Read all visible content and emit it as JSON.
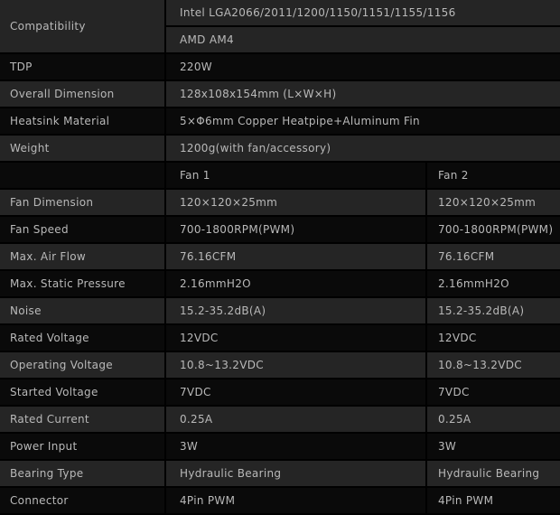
{
  "compatibility": {
    "label": "Compatibility",
    "intel": "Intel LGA2066/2011/1200/1150/1151/1155/1156",
    "amd": "AMD AM4"
  },
  "general": [
    {
      "label": "TDP",
      "value": "220W"
    },
    {
      "label": "Overall Dimension",
      "value": "128x108x154mm (L×W×H)"
    },
    {
      "label": "Heatsink Material",
      "value": "5×Φ6mm Copper Heatpipe+Aluminum Fin"
    },
    {
      "label": "Weight",
      "value": "1200g(with fan/accessory)"
    }
  ],
  "fan_header": {
    "label": "",
    "fan1": "Fan 1",
    "fan2": "Fan 2"
  },
  "fan_specs": [
    {
      "label": "Fan Dimension",
      "fan1": "120×120×25mm",
      "fan2": "120×120×25mm"
    },
    {
      "label": "Fan Speed",
      "fan1": "700-1800RPM(PWM)",
      "fan2": "700-1800RPM(PWM)"
    },
    {
      "label": "Max. Air Flow",
      "fan1": "76.16CFM",
      "fan2": "76.16CFM"
    },
    {
      "label": "Max. Static Pressure",
      "fan1": "2.16mmH2O",
      "fan2": "2.16mmH2O"
    },
    {
      "label": "Noise",
      "fan1": "15.2-35.2dB(A)",
      "fan2": "15.2-35.2dB(A)"
    },
    {
      "label": "Rated Voltage",
      "fan1": "12VDC",
      "fan2": "12VDC"
    },
    {
      "label": "Operating Voltage",
      "fan1": "10.8~13.2VDC",
      "fan2": "10.8~13.2VDC"
    },
    {
      "label": "Started Voltage",
      "fan1": "7VDC",
      "fan2": "7VDC"
    },
    {
      "label": "Rated Current",
      "fan1": "0.25A",
      "fan2": "0.25A"
    },
    {
      "label": "Power Input",
      "fan1": "3W",
      "fan2": "3W"
    },
    {
      "label": "Bearing Type",
      "fan1": "Hydraulic Bearing",
      "fan2": "Hydraulic Bearing"
    },
    {
      "label": "Connector",
      "fan1": "4Pin PWM",
      "fan2": "4Pin PWM"
    }
  ]
}
